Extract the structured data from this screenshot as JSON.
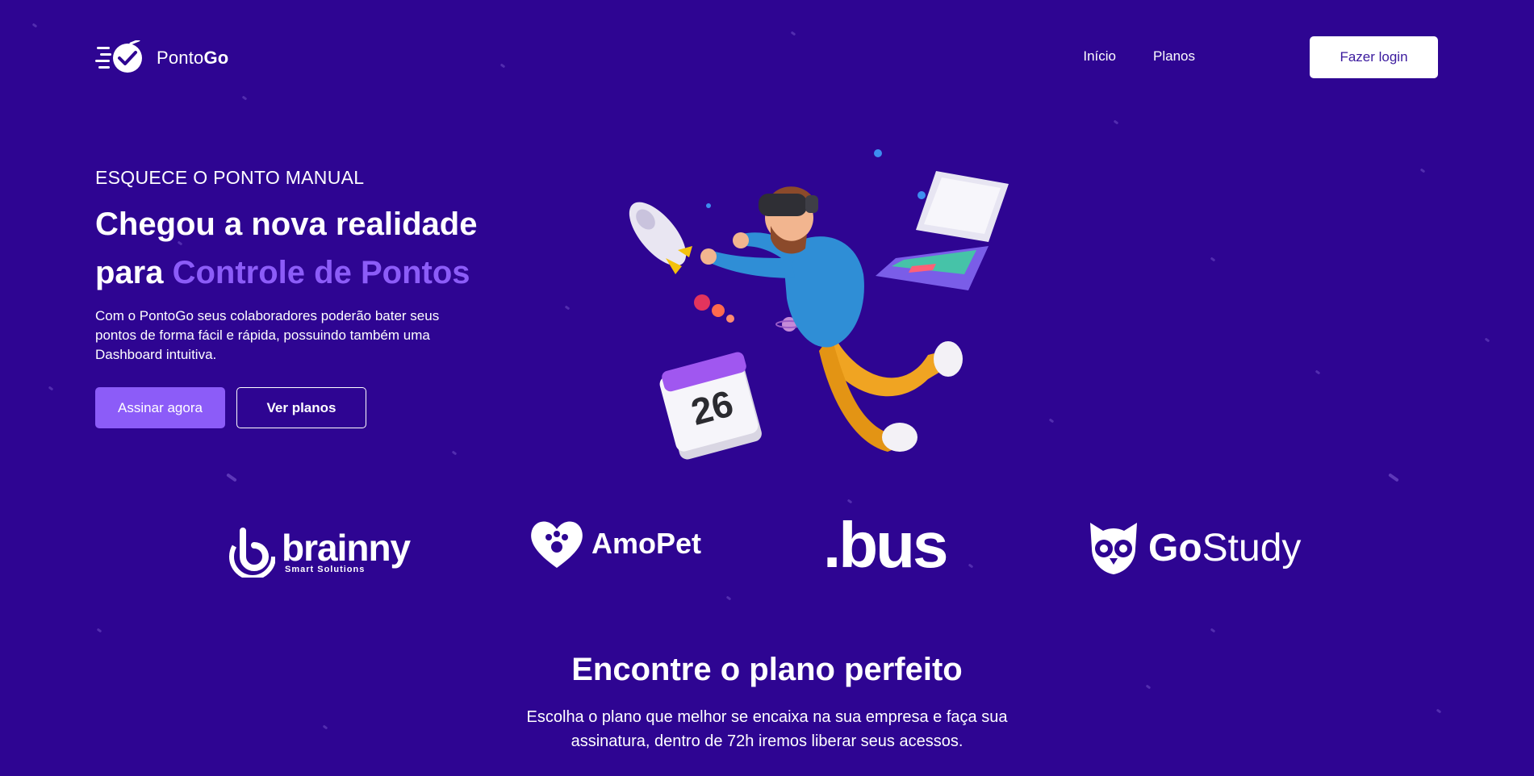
{
  "brand": {
    "name_regular": "Ponto",
    "name_bold": "Go",
    "logo_icon": "clock-check-logo-icon"
  },
  "nav": {
    "items": [
      {
        "label": "Início"
      },
      {
        "label": "Planos"
      }
    ],
    "login_label": "Fazer login"
  },
  "hero": {
    "eyebrow": "ESQUECE O PONTO MANUAL",
    "headline_line1": "Chegou a nova realidade",
    "headline_prefix": "para ",
    "headline_accent": "Controle de Pontos",
    "description": "Com o PontoGo seus colaboradores poderão bater seus pontos de forma fácil e rápida, possuindo também uma Dashboard intuitiva.",
    "primary_button": "Assinar agora",
    "secondary_button": "Ver planos",
    "calendar_day": "26",
    "illustration": "person-with-vr-headset-flying-illustration"
  },
  "partners": [
    {
      "name": "brainny",
      "tagline": "Smart Solutions",
      "icon": "brainny-b-icon"
    },
    {
      "name": "AmoPet",
      "icon": "paw-heart-icon"
    },
    {
      "name": ".bus"
    },
    {
      "name_bold": "Go",
      "name_light": "Study",
      "icon": "owl-icon"
    }
  ],
  "plans": {
    "title": "Encontre o plano perfeito",
    "description": "Escolha o plano que melhor se encaixa na sua empresa e faça sua assinatura, dentro de 72h iremos liberar seus acessos."
  },
  "colors": {
    "background": "#2e0592",
    "accent": "#8c5cf8",
    "white": "#ffffff"
  }
}
